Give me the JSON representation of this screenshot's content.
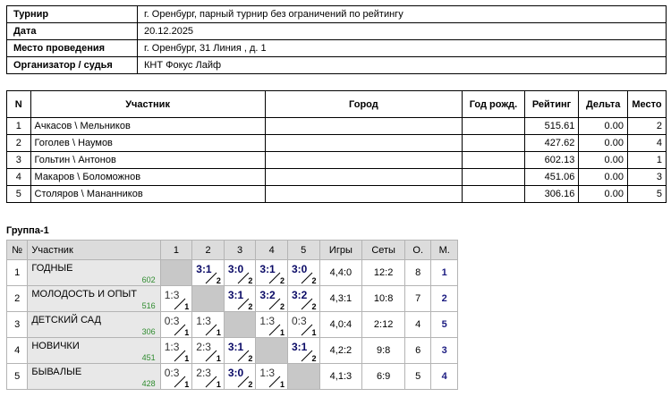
{
  "info": [
    {
      "label": "Турнир",
      "value": "г. Оренбург, парный турнир без ограничений по рейтингу"
    },
    {
      "label": "Дата",
      "value": "20.12.2025"
    },
    {
      "label": "Место проведения",
      "value": "г. Оренбург, 31 Линия , д. 1"
    },
    {
      "label": "Организатор / судья",
      "value": "КНТ Фокус Лайф"
    }
  ],
  "participants": {
    "headers": {
      "n": "N",
      "name": "Участник",
      "city": "Город",
      "year": "Год рожд.",
      "rating": "Рейтинг",
      "delta": "Дельта",
      "place": "Место"
    },
    "rows": [
      {
        "n": "1",
        "name": "Ачкасов \\ Мельников",
        "city": "",
        "year": "",
        "rating": "515.61",
        "delta": "0.00",
        "place": "2"
      },
      {
        "n": "2",
        "name": "Гоголев \\ Наумов",
        "city": "",
        "year": "",
        "rating": "427.62",
        "delta": "0.00",
        "place": "4"
      },
      {
        "n": "3",
        "name": "Гольтин \\ Антонов",
        "city": "",
        "year": "",
        "rating": "602.13",
        "delta": "0.00",
        "place": "1"
      },
      {
        "n": "4",
        "name": "Макаров \\ Боломожнов",
        "city": "",
        "year": "",
        "rating": "451.06",
        "delta": "0.00",
        "place": "3"
      },
      {
        "n": "5",
        "name": "Столяров \\ Мананников",
        "city": "",
        "year": "",
        "rating": "306.16",
        "delta": "0.00",
        "place": "5"
      }
    ]
  },
  "group": {
    "title": "Группа-1",
    "headers": {
      "n": "№",
      "name": "Участник",
      "c1": "1",
      "c2": "2",
      "c3": "3",
      "c4": "4",
      "c5": "5",
      "games": "Игры",
      "sets": "Сеты",
      "points": "О.",
      "place": "М."
    },
    "rows": [
      {
        "n": "1",
        "name": "ГОДНЫЕ",
        "rating": "602",
        "results": [
          null,
          {
            "score": "3:1",
            "pts": "2",
            "win": true
          },
          {
            "score": "3:0",
            "pts": "2",
            "win": true
          },
          {
            "score": "3:1",
            "pts": "2",
            "win": true
          },
          {
            "score": "3:0",
            "pts": "2",
            "win": true
          }
        ],
        "games": "4,4:0",
        "sets": "12:2",
        "points": "8",
        "place": "1"
      },
      {
        "n": "2",
        "name": "МОЛОДОСТЬ И ОПЫТ",
        "rating": "516",
        "results": [
          {
            "score": "1:3",
            "pts": "1",
            "win": false
          },
          null,
          {
            "score": "3:1",
            "pts": "2",
            "win": true
          },
          {
            "score": "3:2",
            "pts": "2",
            "win": true
          },
          {
            "score": "3:2",
            "pts": "2",
            "win": true
          }
        ],
        "games": "4,3:1",
        "sets": "10:8",
        "points": "7",
        "place": "2"
      },
      {
        "n": "3",
        "name": "ДЕТСКИЙ САД",
        "rating": "306",
        "results": [
          {
            "score": "0:3",
            "pts": "1",
            "win": false
          },
          {
            "score": "1:3",
            "pts": "1",
            "win": false
          },
          null,
          {
            "score": "1:3",
            "pts": "1",
            "win": false
          },
          {
            "score": "0:3",
            "pts": "1",
            "win": false
          }
        ],
        "games": "4,0:4",
        "sets": "2:12",
        "points": "4",
        "place": "5"
      },
      {
        "n": "4",
        "name": "НОВИЧКИ",
        "rating": "451",
        "results": [
          {
            "score": "1:3",
            "pts": "1",
            "win": false
          },
          {
            "score": "2:3",
            "pts": "1",
            "win": false
          },
          {
            "score": "3:1",
            "pts": "2",
            "win": true
          },
          null,
          {
            "score": "3:1",
            "pts": "2",
            "win": true
          }
        ],
        "games": "4,2:2",
        "sets": "9:8",
        "points": "6",
        "place": "3"
      },
      {
        "n": "5",
        "name": "БЫВАЛЫЕ",
        "rating": "428",
        "results": [
          {
            "score": "0:3",
            "pts": "1",
            "win": false
          },
          {
            "score": "2:3",
            "pts": "1",
            "win": false
          },
          {
            "score": "3:0",
            "pts": "2",
            "win": true
          },
          {
            "score": "1:3",
            "pts": "1",
            "win": false
          },
          null
        ],
        "games": "4,1:3",
        "sets": "6:9",
        "points": "5",
        "place": "4"
      }
    ]
  }
}
